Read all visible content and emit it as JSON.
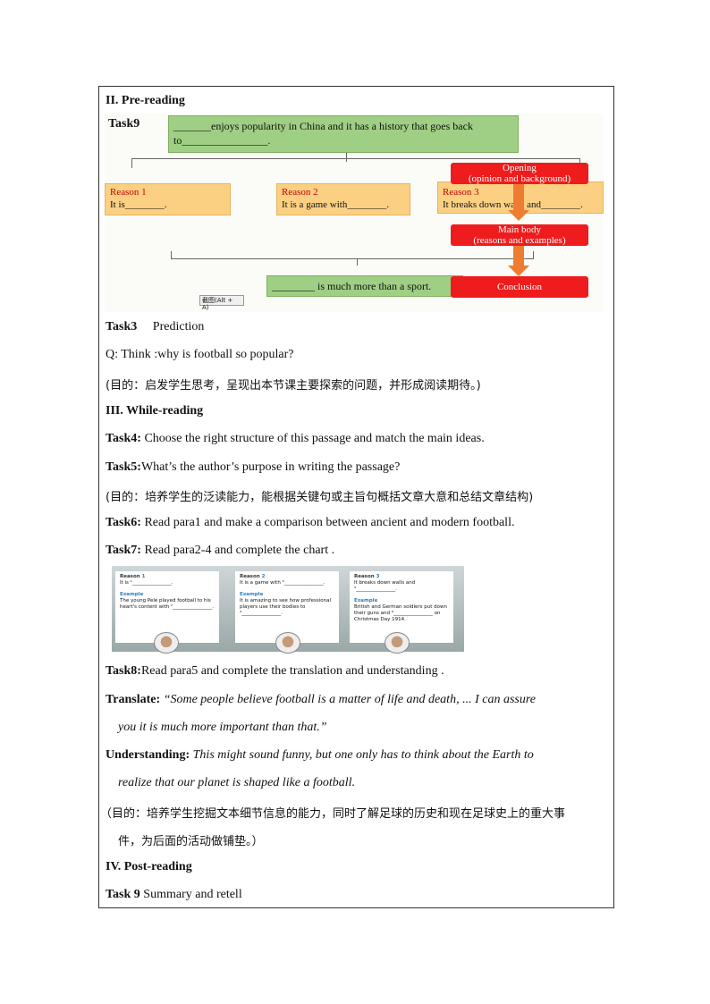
{
  "section2": {
    "title": "II. Pre-reading"
  },
  "task9_diagram": {
    "label": "Task9",
    "top_box": "_______enjoys popularity in China and it has a history that goes back to________________.",
    "reason1_title": "Reason 1",
    "reason1_text": "It is________.",
    "reason2_title": "Reason 2",
    "reason2_text": "It is a game with________.",
    "reason3_title": "Reason 3",
    "reason3_text": "It breaks down walls and________.",
    "bottom_box": "________ is much more than a sport.",
    "opening": "Opening\n(opinion and background)",
    "main_body": "Main body\n(reasons and examples)",
    "conclusion": "Conclusion",
    "screenshot_hint": "截图(Alt + A)"
  },
  "task3": {
    "label": "Task3",
    "text": "Prediction"
  },
  "question": "Q: Think  :why  is  football  so  popular?",
  "purpose1": "(目的：启发学生思考，呈现出本节课主要探索的问题，并形成阅读期待。)",
  "section3": {
    "title": "III. While-reading"
  },
  "task4": {
    "label": "Task4:",
    "text": " Choose  the  right   structure   of  this  passage  and  match   the  main  ideas."
  },
  "task5": {
    "label": "Task5:",
    "text": "What’s  the  author’s  purpose  in  writing   the  passage?"
  },
  "purpose2": "(目的：培养学生的泛读能力，能根据关键句或主旨句概括文章大意和总结文章结构)",
  "task6": {
    "label": "Task6:",
    "text": " Read  para1  and make  a  comparison   between  ancient   and  modern  football."
  },
  "task7": {
    "label": "Task7:",
    "text": " Read  para2-4  and  complete   the   chart  ."
  },
  "task7_cards": [
    {
      "reason": "Reason",
      "num": "1",
      "line": "It is ¹________________.",
      "example": "Example",
      "body": "The young Pelé played football to his heart's content with ²________________."
    },
    {
      "reason": "Reason",
      "num": "2",
      "line": "It is a game with ³________________.",
      "example": "Example",
      "body": "It is amazing to see how professional players use their bodies to ⁴________________."
    },
    {
      "reason": "Reason",
      "num": "3",
      "line": "It breaks down walls and ⁵________________.",
      "example": "Example",
      "body": "British and German soldiers put down their guns and ⁶________________ on Christmas Day 1914."
    }
  ],
  "task8": {
    "label": "Task8:",
    "text": "Read  para5  and  complete   the  translation    and  understanding    ."
  },
  "translate": {
    "label": "Translate:",
    "text1": " “Some  people  believe  football  is  a  matter  of  life  and  death,  ...  I  can  assure",
    "text2": "you  it  is  much  more  important  than  that.”"
  },
  "understanding": {
    "label": "Understanding:",
    "text1": "  This  might  sound  funny,  but  one  only  has  to  think  about  the  Earth  to",
    "text2": "realize  that  our  planet  is  shaped  like  a  football."
  },
  "purpose3": {
    "line1": "（目的：培养学生挖掘文本细节信息的能力，同时了解足球的历史和现在足球史上的重大事",
    "line2": "件，为后面的活动做铺垫。）"
  },
  "section4": {
    "title": "IV. Post-reading"
  },
  "task9": {
    "label": "Task 9",
    "text": "    Summary   and  retell"
  }
}
